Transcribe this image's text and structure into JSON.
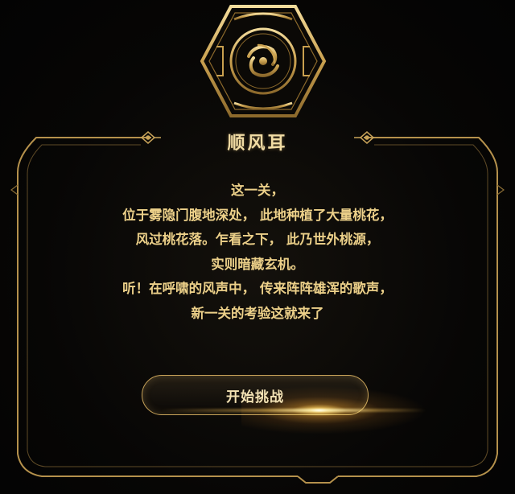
{
  "level": {
    "title": "顺风耳",
    "emblem_icon": "wind-swirl-icon"
  },
  "story": {
    "lines": [
      "这一关，",
      "位于雾隐门腹地深处，  此地种植了大量桃花，",
      "风过桃花落。乍看之下，  此乃世外桃源，",
      "实则暗藏玄机。",
      "听！在呼啸的风声中，  传来阵阵雄浑的歌声，",
      "新一关的考验这就来了"
    ]
  },
  "actions": {
    "start_label": "开始挑战"
  },
  "colors": {
    "gold": "#c9a45a",
    "text": "#ecd089",
    "background": "#060504"
  }
}
